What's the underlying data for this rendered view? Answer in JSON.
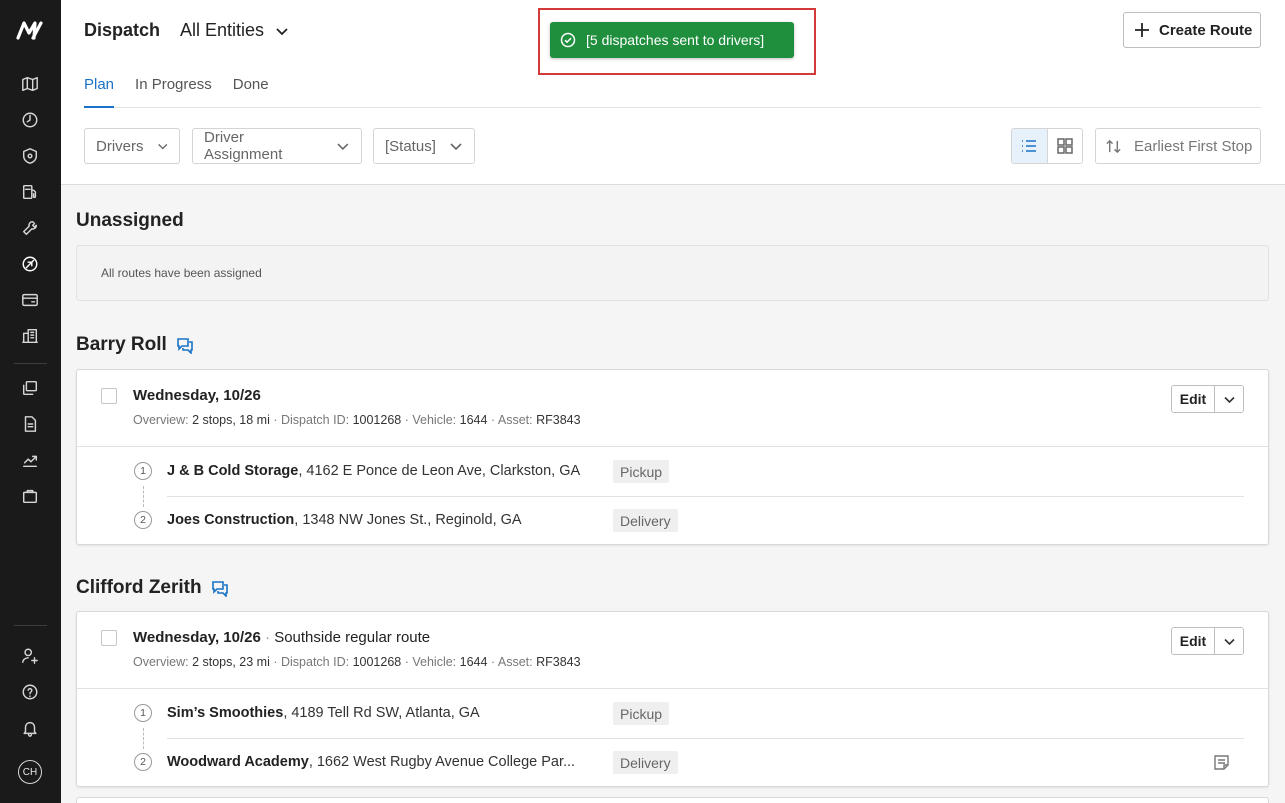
{
  "sidebar": {
    "logo_text": "M",
    "top_icons": [
      "map-icon",
      "clock-icon",
      "shield-icon",
      "fuel-icon",
      "wrench-icon",
      "dispatch-icon",
      "card-icon",
      "building-icon"
    ],
    "mid_icons": [
      "documents-icon",
      "report-icon",
      "analytics-icon",
      "bag-icon"
    ],
    "bottom_icons": [
      "user-settings-icon",
      "help-icon",
      "bell-icon"
    ],
    "avatar_initials": "CH"
  },
  "header": {
    "title": "Dispatch",
    "entity_select": "All Entities",
    "create_label": "Create Route",
    "tabs": [
      {
        "label": "Plan",
        "active": true
      },
      {
        "label": "In Progress",
        "active": false
      },
      {
        "label": "Done",
        "active": false
      }
    ],
    "filters": {
      "drivers": "Drivers",
      "driver_assignment": "Driver Assignment",
      "status": "[Status]"
    },
    "sort_label": "Earliest First Stop"
  },
  "toast": {
    "message": "[5 dispatches sent to drivers]",
    "color": "#1f8e3d"
  },
  "unassigned": {
    "title": "Unassigned",
    "empty_message": "All routes have been assigned"
  },
  "routes": [
    {
      "driver": "Barry Roll",
      "date": "Wednesday, 10/26",
      "route_name": "",
      "overview_label": "Overview:",
      "overview": "2 stops, 18 mi",
      "dispatch_label": "Dispatch ID:",
      "dispatch_id": "1001268",
      "vehicle_label": "Vehicle:",
      "vehicle": "1644",
      "asset_label": "Asset:",
      "asset": "RF3843",
      "edit_label": "Edit",
      "stops": [
        {
          "num": "1",
          "name": "J & B Cold Storage",
          "address": ", 4162 E Ponce de Leon Ave, Clarkston, GA",
          "type": "Pickup"
        },
        {
          "num": "2",
          "name": "Joes Construction",
          "address": ", 1348 NW Jones St., Reginold, GA",
          "type": "Delivery"
        }
      ]
    },
    {
      "driver": "Clifford Zerith",
      "date": "Wednesday, 10/26",
      "route_name": "Southside regular route",
      "overview_label": "Overview:",
      "overview": "2 stops, 23 mi",
      "dispatch_label": "Dispatch ID:",
      "dispatch_id": "1001268",
      "vehicle_label": "Vehicle:",
      "vehicle": "1644",
      "asset_label": "Asset:",
      "asset": "RF3843",
      "edit_label": "Edit",
      "stops": [
        {
          "num": "1",
          "name": "Sim’s Smoothies",
          "address": ", 4189 Tell Rd SW, Atlanta, GA",
          "type": "Pickup"
        },
        {
          "num": "2",
          "name": "Woodward Academy",
          "address": ", 1662 West Rugby Avenue College Par...",
          "type": "Delivery"
        }
      ]
    }
  ]
}
